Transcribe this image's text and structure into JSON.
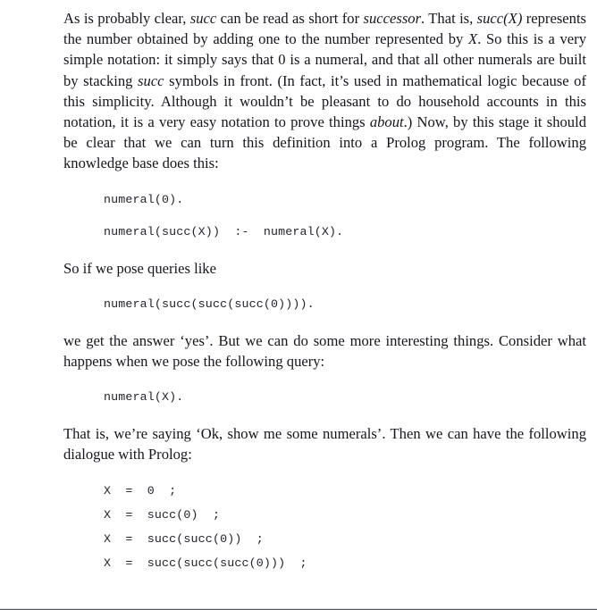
{
  "document": {
    "type": "textbook-page",
    "topic": "Prolog numerals",
    "background_color": "#ffffff",
    "text_color": "#16161c"
  },
  "paragraphs": {
    "p1": {
      "seg1": "As is probably clear, ",
      "em1": "succ",
      "seg2": " can be read as short for ",
      "em2": "successor",
      "seg3": ". That is, ",
      "em3": "succ(X)",
      "seg4": " represents the number obtained by adding one to the number represented by ",
      "em4": "X",
      "seg5": ". So this is a very simple notation: it simply says that 0 is a numeral, and that all other numerals are built by stacking ",
      "em5": "succ",
      "seg6": " symbols in front. (In fact, it’s used in mathematical logic because of this simplicity. Although it wouldn’t be pleasant to do household accounts in this notation, it is a very easy notation to prove things ",
      "em6": "about",
      "seg7": ".) Now, by this stage it should be clear that we can turn this definition into a Prolog program. The following knowledge base does this:"
    },
    "p2": "So if we pose queries like",
    "p3": "we get the answer ‘yes’. But we can do some more interesting things. Consider what happens when we pose the following query:",
    "p4": "That is, we’re saying ‘Ok, show me some numerals’. Then we can have the following dialogue with Prolog:"
  },
  "code_blocks": {
    "knowledge_base": [
      "numeral(0).",
      "numeral(succ(X))  :-  numeral(X)."
    ],
    "query_ground": [
      "numeral(succ(succ(succ(0))))."
    ],
    "query_variable": [
      "numeral(X)."
    ],
    "dialogue": [
      "X  =  0  ;",
      "X  =  succ(0)  ;",
      "X  =  succ(succ(0))  ;",
      "X  =  succ(succ(succ(0)))  ;"
    ]
  }
}
